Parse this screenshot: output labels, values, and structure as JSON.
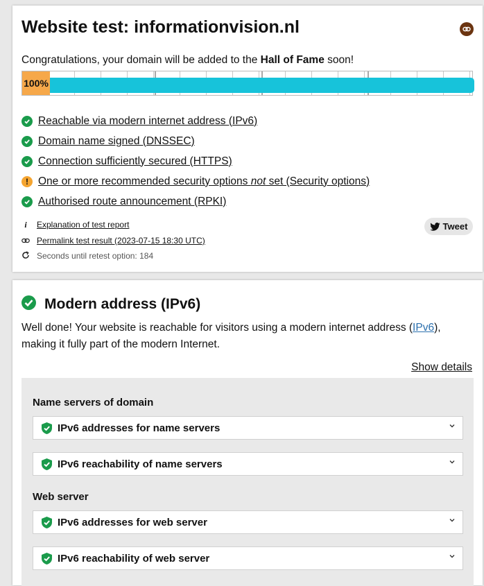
{
  "report": {
    "title": "Website test: informationvision.nl",
    "congrats_prefix": "Congratulations, your domain will be added to the ",
    "congrats_bold": "Hall of Fame",
    "congrats_suffix": " soon!",
    "progress": {
      "value_label": "100%",
      "percent": 100
    },
    "checks": [
      {
        "label": "Reachable via modern internet address (IPv6)",
        "status": "ok"
      },
      {
        "label": "Domain name signed (DNSSEC)",
        "status": "ok"
      },
      {
        "label": "Connection sufficiently secured (HTTPS)",
        "status": "ok"
      },
      {
        "label_pre": "One or more recommended security options ",
        "label_em": "not",
        "label_post": " set (Security options)",
        "status": "warn"
      },
      {
        "label": "Authorised route announcement (RPKI)",
        "status": "ok"
      }
    ],
    "explanation_link": "Explanation of test report",
    "permalink": "Permalink test result (2023-07-15 18:30 UTC)",
    "retest": "Seconds until retest option: 184",
    "tweet_label": "Tweet"
  },
  "ipv6": {
    "title": "Modern address (IPv6)",
    "desc_prefix": "Well done! Your website is reachable for visitors using a modern internet address (",
    "desc_link": "IPv6",
    "desc_suffix": "), making it fully part of the modern Internet.",
    "show_details": "Show details",
    "groups": [
      {
        "label": "Name servers of domain",
        "items": [
          "IPv6 addresses for name servers",
          "IPv6 reachability of name servers"
        ]
      },
      {
        "label": "Web server",
        "items": [
          "IPv6 addresses for web server",
          "IPv6 reachability of web server"
        ]
      }
    ]
  },
  "colors": {
    "ok": "#1a9b4b",
    "warn": "#f5a531",
    "progress_fill": "#17c3da",
    "progress_label_bg": "#f6a84a",
    "permalink_badge": "#6b3410"
  }
}
